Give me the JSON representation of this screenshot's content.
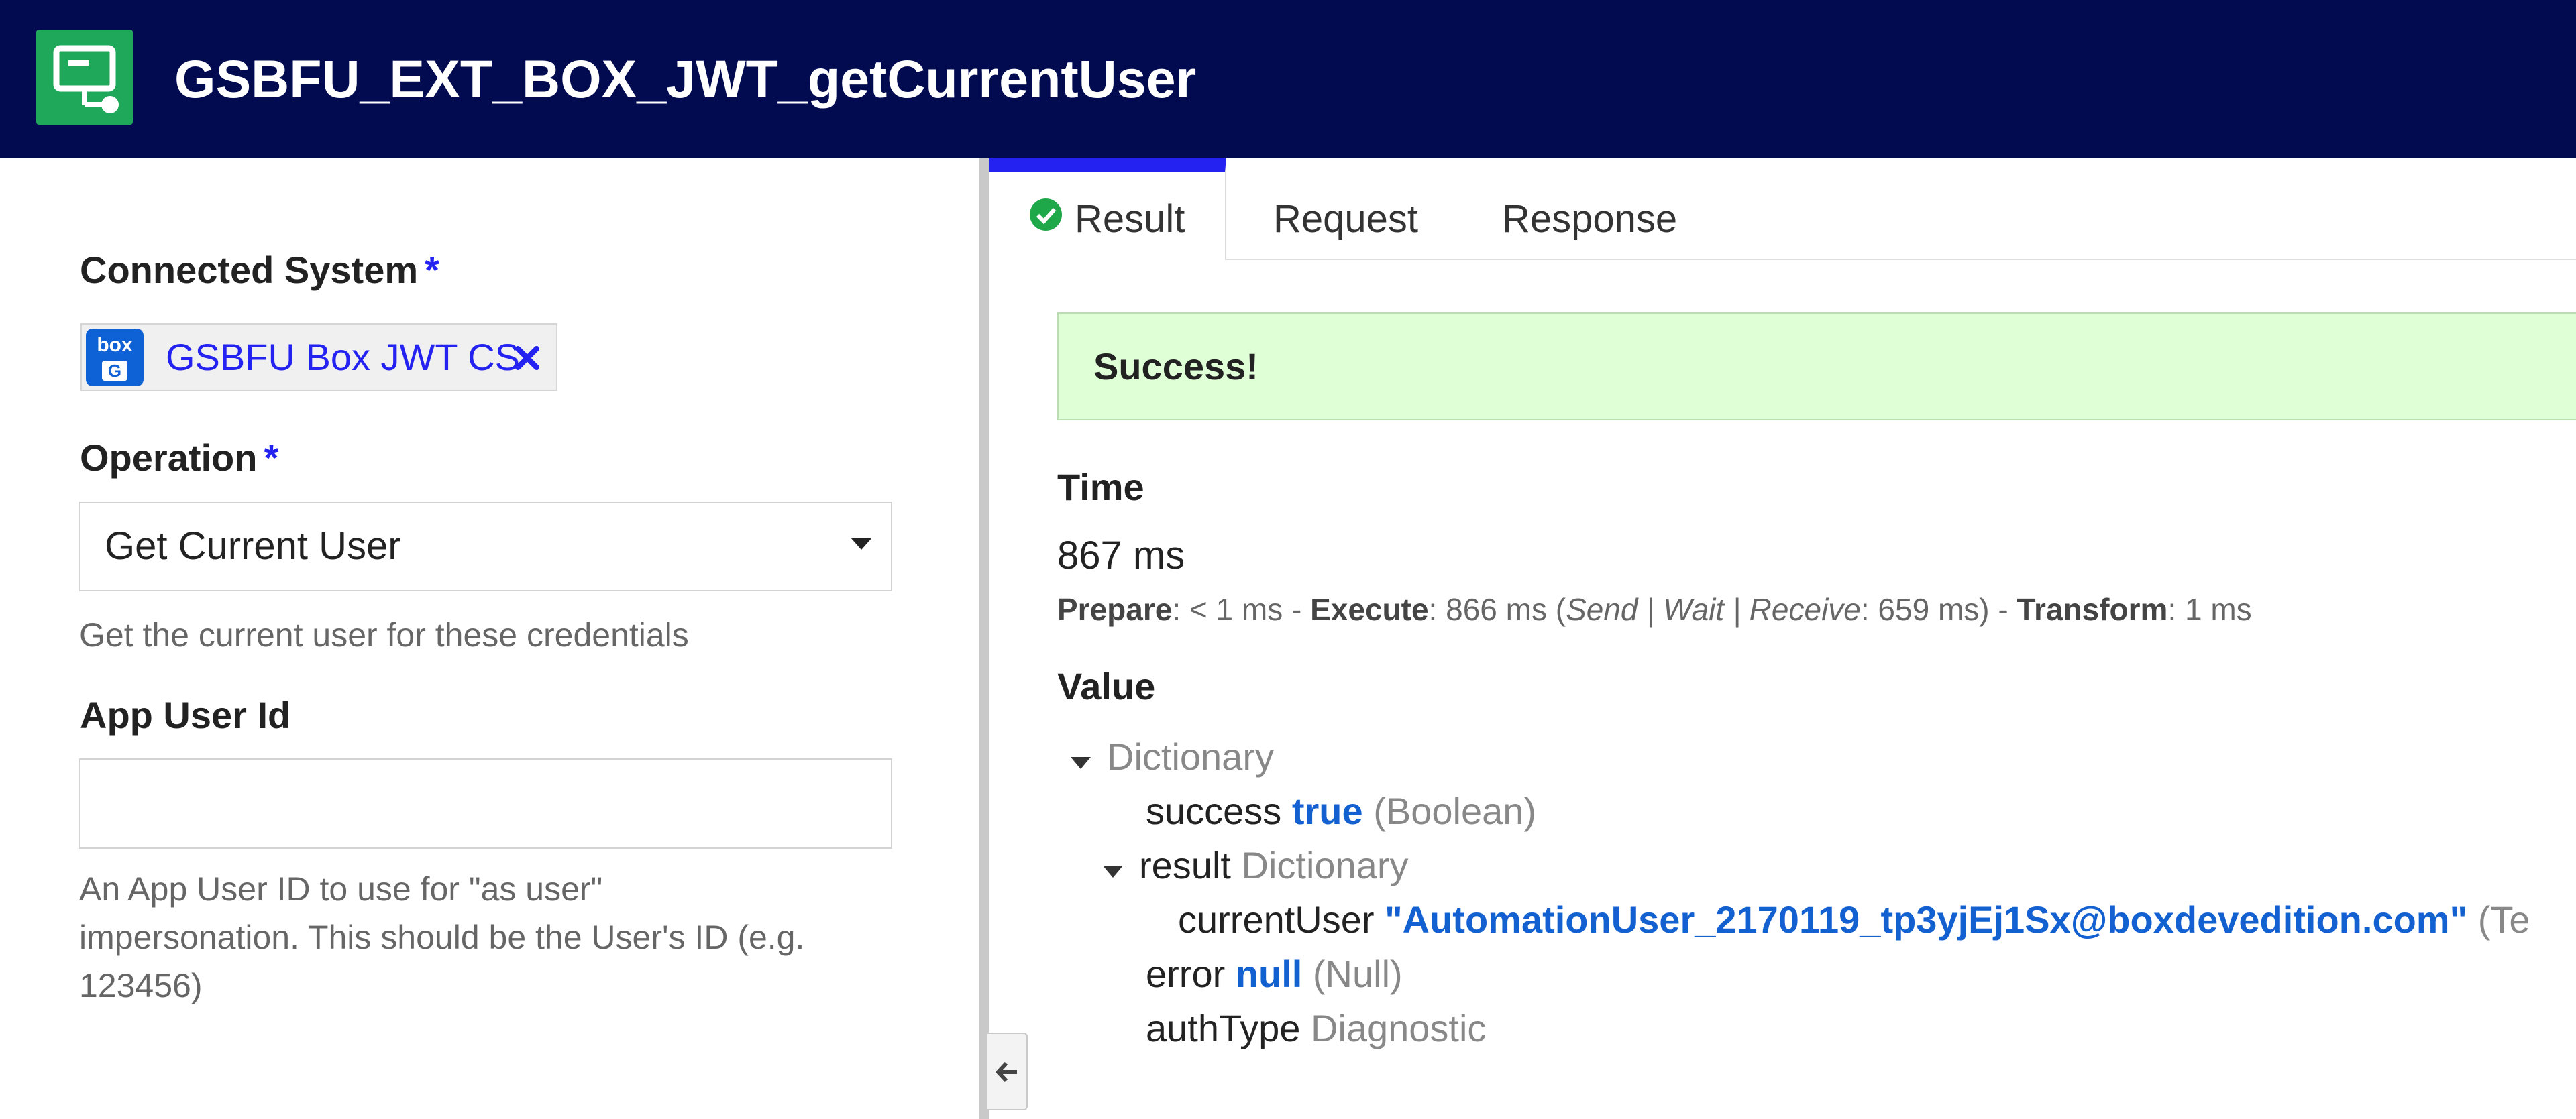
{
  "header": {
    "title": "GSBFU_EXT_BOX_JWT_getCurrentUser",
    "icon": "integration-icon",
    "background": "#020b50",
    "icon_color": "#1fa85a"
  },
  "left": {
    "connected_system": {
      "label": "Connected System",
      "required_mark": "*",
      "chip": {
        "logo_text_top": "box",
        "logo_text_bottom": "G",
        "text": "GSBFU Box JWT CS"
      }
    },
    "operation": {
      "label": "Operation",
      "required_mark": "*",
      "selected": "Get Current User",
      "help": "Get the current user for these credentials"
    },
    "app_user_id": {
      "label": "App User Id",
      "value": "",
      "help_lines": [
        "An App User ID to use for \"as user\"",
        "impersonation. This should be the User's ID (e.g.",
        "123456)"
      ]
    }
  },
  "tabs": [
    {
      "label": "Result",
      "active": true
    },
    {
      "label": "Request",
      "active": false
    },
    {
      "label": "Response",
      "active": false
    }
  ],
  "result": {
    "banner": "Success!",
    "time_title": "Time",
    "time_value": "867 ms",
    "timing": {
      "prepare_label": "Prepare",
      "prepare_value": ": < 1 ms - ",
      "execute_label": "Execute",
      "execute_value": ": 866 ms (",
      "send_wait_receive": "Send | Wait | Receive",
      "swr_value": ": 659 ms) - ",
      "transform_label": "Transform",
      "transform_value": ": 1 ms"
    },
    "value_title": "Value",
    "tree": {
      "root": "Dictionary",
      "success_key": "success",
      "success_value": "true",
      "success_type": "(Boolean)",
      "result_key": "result",
      "result_type": "Dictionary",
      "current_user_key": "currentUser",
      "current_user_value": "\"AutomationUser_2170119_tp3yjEj1Sx@boxdevedition.com\"",
      "current_user_type": "(Te",
      "error_key": "error",
      "error_value": "null",
      "error_type": "(Null)",
      "auth_key": "authType",
      "auth_value": "Diagnostic"
    }
  },
  "colors": {
    "accent": "#2322f0",
    "success_bg": "#dfffd6",
    "value_blue": "#1361d0"
  }
}
